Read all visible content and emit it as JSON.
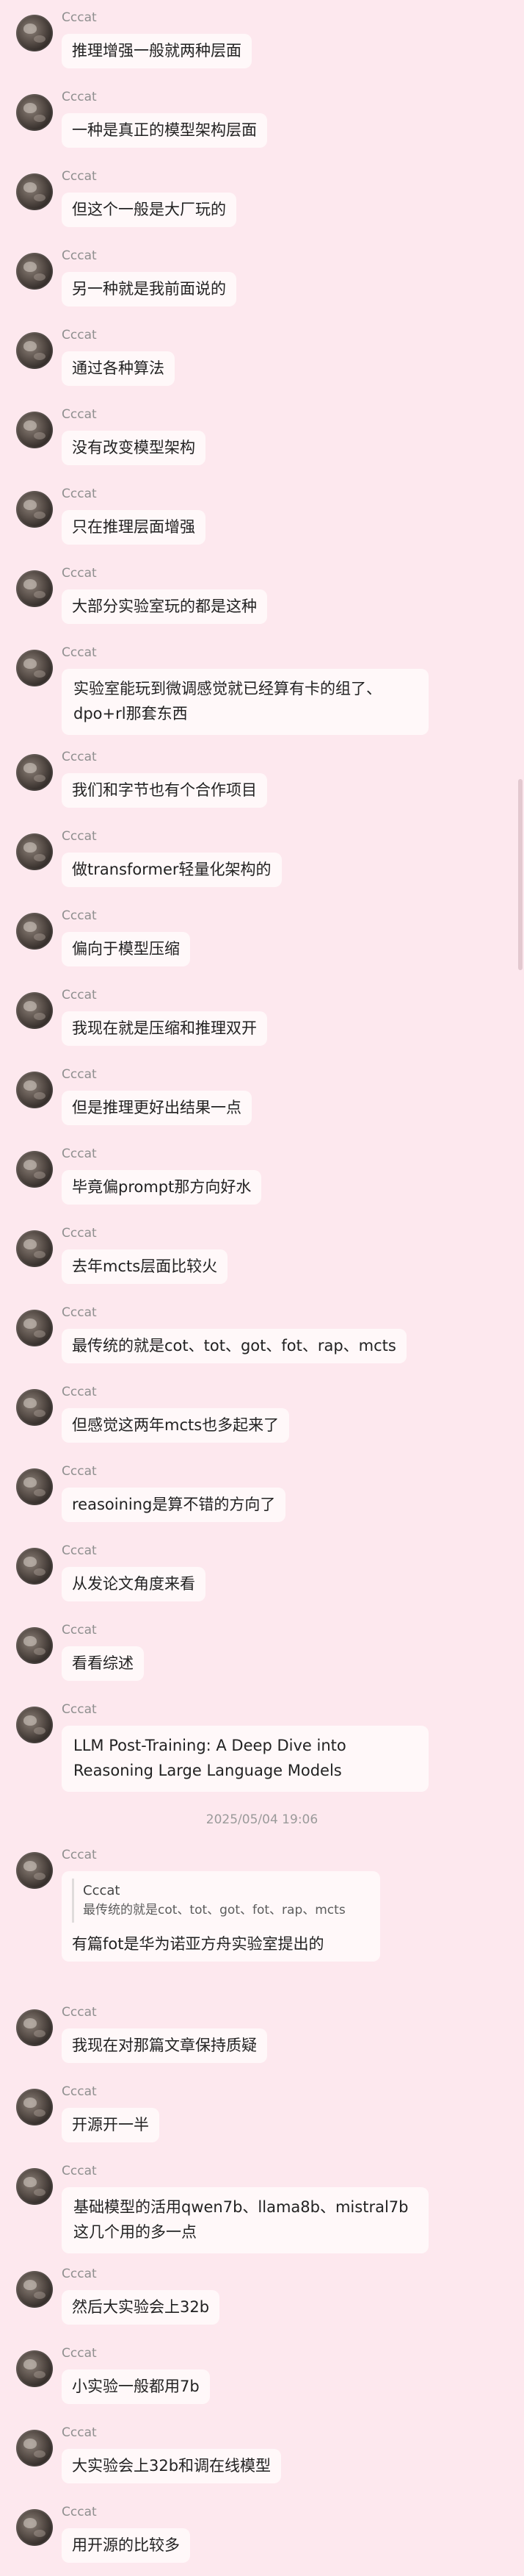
{
  "sender": "Cccat",
  "messages": [
    {
      "text": "推理增强一般就两种层面"
    },
    {
      "text": "一种是真正的模型架构层面"
    },
    {
      "text": "但这个一般是大厂玩的"
    },
    {
      "text": "另一种就是我前面说的"
    },
    {
      "text": "通过各种算法"
    },
    {
      "text": "没有改变模型架构"
    },
    {
      "text": "只在推理层面增强"
    },
    {
      "text": "大部分实验室玩的都是这种"
    },
    {
      "text": "实验室能玩到微调感觉就已经算有卡的组了、dpo+rl那套东西"
    },
    {
      "text": "我们和字节也有个合作项目"
    },
    {
      "text": "做transformer轻量化架构的"
    },
    {
      "text": "偏向于模型压缩"
    },
    {
      "text": "我现在就是压缩和推理双开"
    },
    {
      "text": "但是推理更好出结果一点"
    },
    {
      "text": "毕竟偏prompt那方向好水"
    },
    {
      "text": "去年mcts层面比较火"
    },
    {
      "text": "最传统的就是cot、tot、got、fot、rap、mcts"
    },
    {
      "text": "但感觉这两年mcts也多起来了"
    },
    {
      "text": "reasoining是算不错的方向了"
    },
    {
      "text": "从发论文角度来看"
    },
    {
      "text": "看看综述"
    },
    {
      "text": "LLM Post-Training: A Deep Dive into Reasoning Large Language Models"
    },
    {
      "text": "有篇fot是华为诺亚方舟实验室提出的",
      "quote_sender": "Cccat",
      "quote_text": "最传统的就是cot、tot、got、fot、rap、mcts"
    },
    {
      "text": "我现在对那篇文章保持质疑"
    },
    {
      "text": "开源开一半"
    },
    {
      "text": "基础模型的活用qwen7b、llama8b、mistral7b这几个用的多一点"
    },
    {
      "text": "然后大实验会上32b"
    },
    {
      "text": "小实验一般都用7b"
    },
    {
      "text": "大实验会上32b和调在线模型"
    },
    {
      "text": "用开源的比较多"
    }
  ],
  "timestamp": "2025/05/04 19:06"
}
